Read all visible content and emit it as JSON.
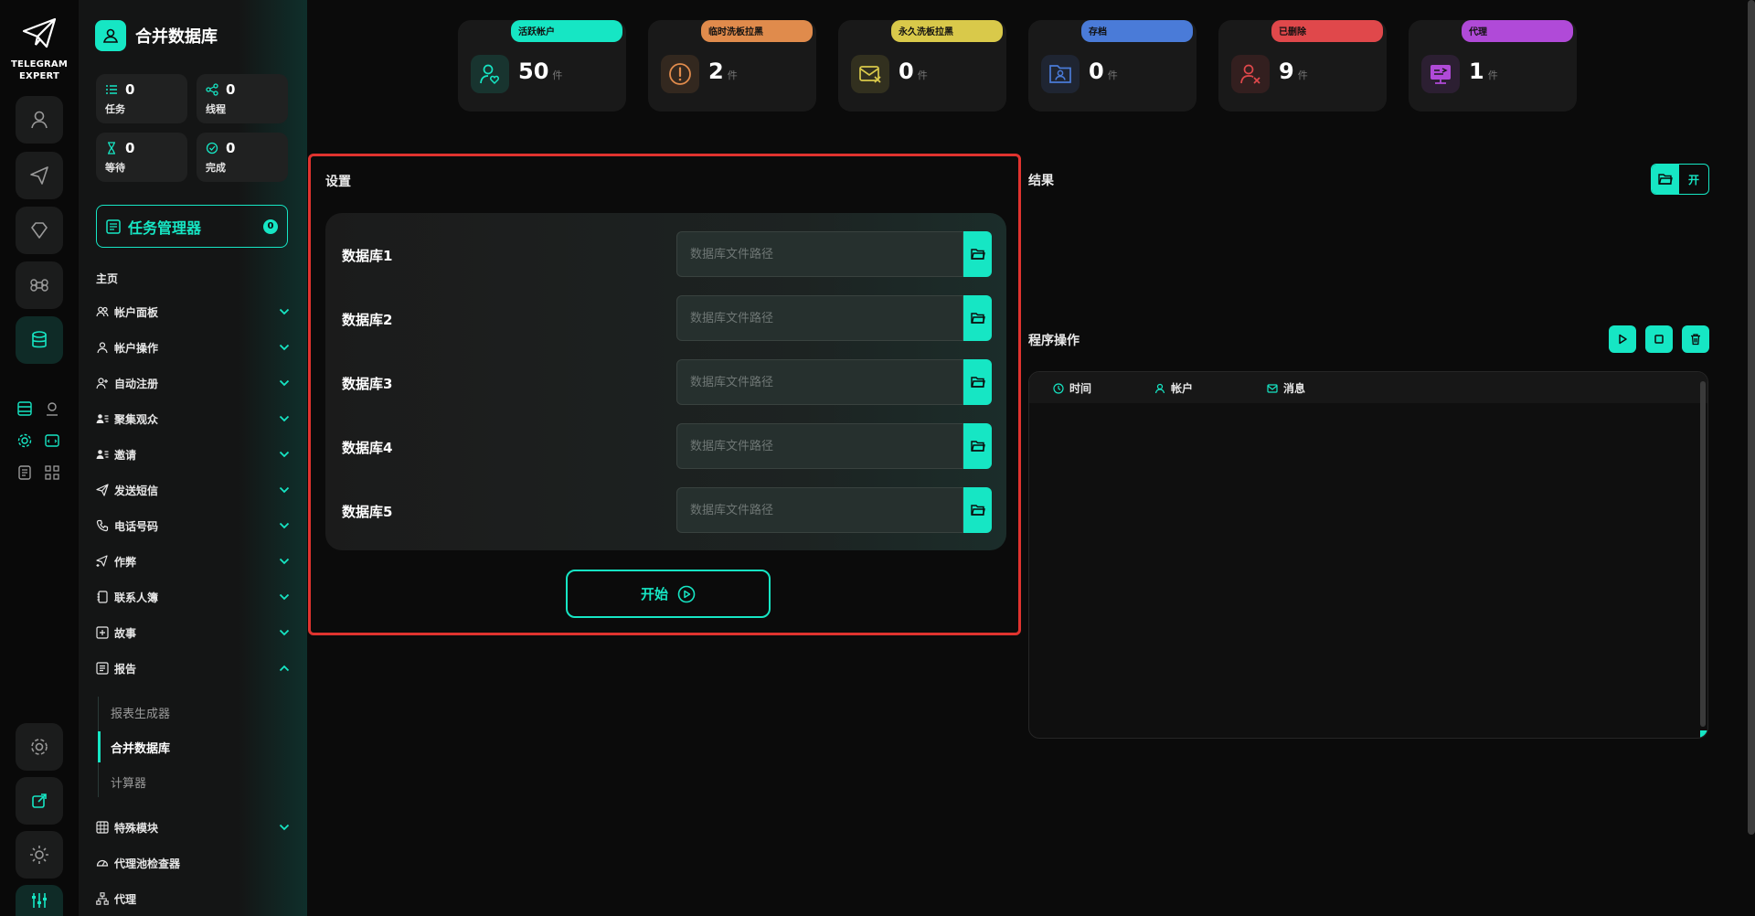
{
  "brand": {
    "line1": "TELEGRAM",
    "line2": "EXPERT"
  },
  "sidebar": {
    "title": "合并数据库",
    "stats": [
      {
        "value": "0",
        "label": "任务",
        "icon": "task-list-icon"
      },
      {
        "value": "0",
        "label": "线程",
        "icon": "share-nodes-icon"
      },
      {
        "value": "0",
        "label": "等待",
        "icon": "hourglass-icon"
      },
      {
        "value": "0",
        "label": "完成",
        "icon": "check-circle-icon"
      }
    ],
    "task_manager": {
      "label": "任务管理器",
      "count": "0"
    },
    "home_label": "主页",
    "nav": [
      {
        "label": "帐户面板",
        "icon": "users-icon"
      },
      {
        "label": "帐户操作",
        "icon": "user-icon"
      },
      {
        "label": "自动注册",
        "icon": "user-plus-icon"
      },
      {
        "label": "聚集观众",
        "icon": "user-list-icon"
      },
      {
        "label": "邀请",
        "icon": "user-list-icon"
      },
      {
        "label": "发送短信",
        "icon": "send-icon"
      },
      {
        "label": "电话号码",
        "icon": "phone-icon"
      },
      {
        "label": "作弊",
        "icon": "send-plus-icon"
      },
      {
        "label": "联系人簿",
        "icon": "contact-book-icon"
      },
      {
        "label": "故事",
        "icon": "plus-square-icon"
      },
      {
        "label": "报告",
        "icon": "report-icon"
      }
    ],
    "sub": [
      {
        "label": "报表生成器"
      },
      {
        "label": "合并数据库"
      },
      {
        "label": "计算器"
      }
    ],
    "nav_bottom": [
      {
        "label": "特殊模块",
        "icon": "grid-icon"
      },
      {
        "label": "代理池检查器",
        "icon": "gauge-icon"
      },
      {
        "label": "代理",
        "icon": "network-icon"
      }
    ]
  },
  "top_stats": [
    {
      "tag": "活跃帐户",
      "value": "50",
      "unit": "件",
      "color": "#16e6c4",
      "icon": "user-heart-icon"
    },
    {
      "tag": "临时洗板拉黑",
      "value": "2",
      "unit": "件",
      "color": "#e08b4c",
      "icon": "warning-circle-icon"
    },
    {
      "tag": "永久洗板拉黑",
      "value": "0",
      "unit": "件",
      "color": "#d9c94a",
      "icon": "mail-x-icon"
    },
    {
      "tag": "存档",
      "value": "0",
      "unit": "件",
      "color": "#4a7bd8",
      "icon": "folder-user-icon"
    },
    {
      "tag": "已删除",
      "value": "9",
      "unit": "件",
      "color": "#e0484b",
      "icon": "user-x-icon"
    },
    {
      "tag": "代理",
      "value": "1",
      "unit": "件",
      "color": "#b04ad8",
      "icon": "proxy-screen-icon"
    }
  ],
  "settings": {
    "title": "设置",
    "rows": [
      {
        "label": "数据库1",
        "placeholder": "数据库文件路径",
        "value": ""
      },
      {
        "label": "数据库2",
        "placeholder": "数据库文件路径",
        "value": ""
      },
      {
        "label": "数据库3",
        "placeholder": "数据库文件路径",
        "value": ""
      },
      {
        "label": "数据库4",
        "placeholder": "数据库文件路径",
        "value": ""
      },
      {
        "label": "数据库5",
        "placeholder": "数据库文件路径",
        "value": ""
      }
    ],
    "start_label": "开始"
  },
  "results": {
    "title": "结果",
    "toggle_label": "开"
  },
  "operations": {
    "title": "程序操作",
    "columns": [
      {
        "label": "时间",
        "icon": "clock-icon"
      },
      {
        "label": "帐户",
        "icon": "user-icon"
      },
      {
        "label": "消息",
        "icon": "mail-icon"
      }
    ]
  },
  "colors": {
    "accent": "#16e6c4",
    "highlight_border": "#e0332f"
  }
}
